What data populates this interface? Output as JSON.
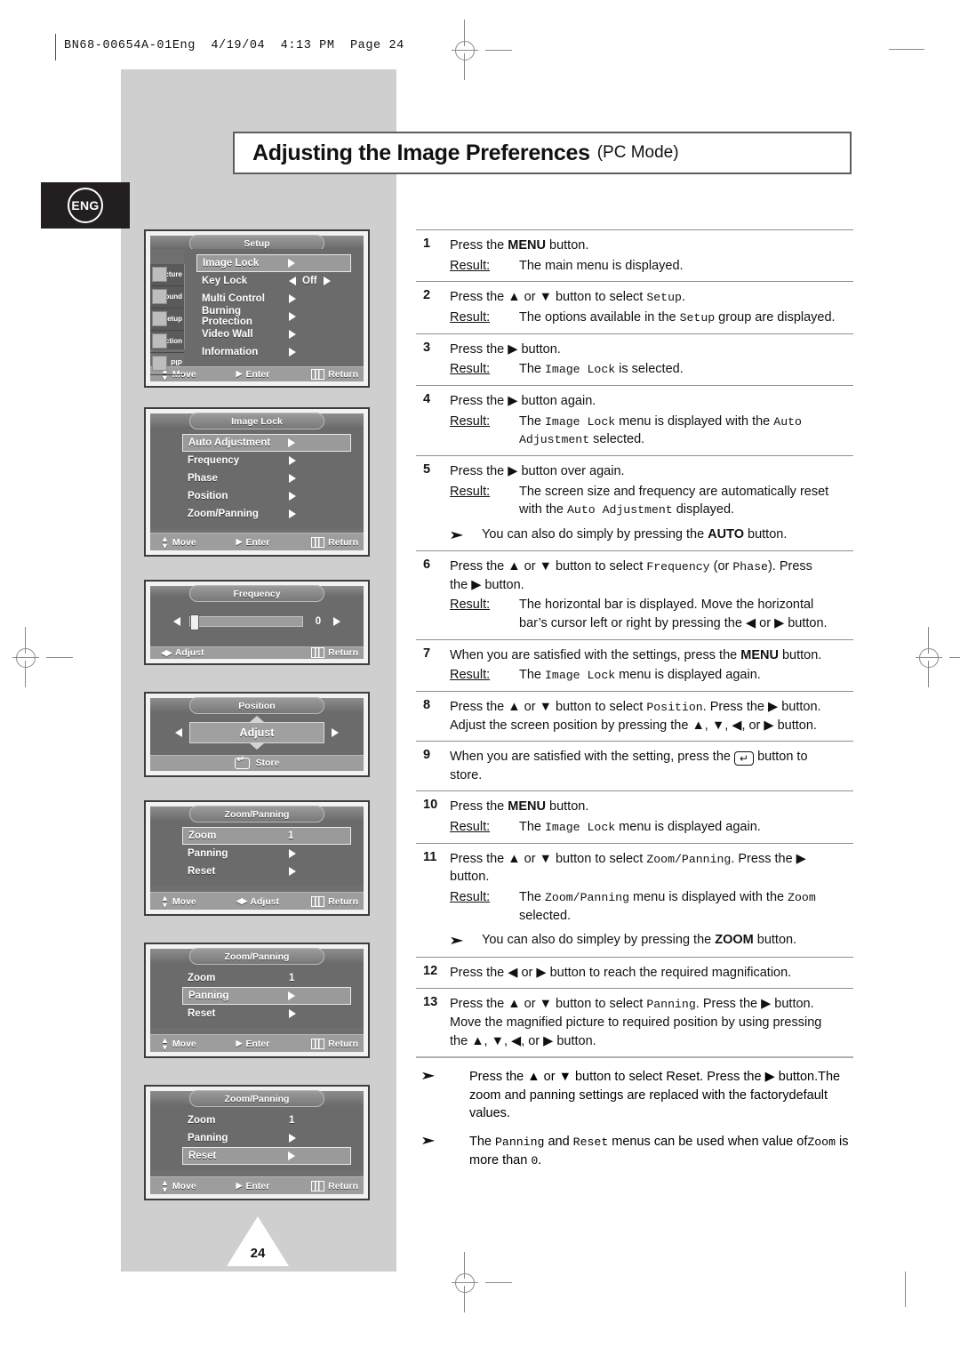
{
  "print": {
    "slug": "BN68-00654A-01Eng  4/19/04  4:13 PM  Page 24",
    "page_number": "24",
    "lang_badge": "ENG"
  },
  "title": {
    "main": "Adjusting the Image Preferences",
    "sub": "(PC Mode)"
  },
  "osd": {
    "setup": {
      "title": "Setup",
      "sidebar": [
        "Picture",
        "Sound",
        "Setup",
        "Function",
        "PIP"
      ],
      "rows": [
        {
          "label": "Image Lock",
          "value": "",
          "arrow": "right",
          "selected": true
        },
        {
          "label": "Key Lock",
          "value": "Off",
          "arrow": "leftright",
          "selected": false
        },
        {
          "label": "Multi Control",
          "value": "",
          "arrow": "right",
          "selected": false
        },
        {
          "label": "Burning Protection",
          "value": "",
          "arrow": "right",
          "selected": false
        },
        {
          "label": "Video Wall",
          "value": "",
          "arrow": "right",
          "selected": false
        },
        {
          "label": "Information",
          "value": "",
          "arrow": "right",
          "selected": false
        }
      ],
      "footer": [
        "Move",
        "Enter",
        "Return"
      ]
    },
    "image_lock": {
      "title": "Image Lock",
      "rows": [
        {
          "label": "Auto Adjustment",
          "arrow": "right",
          "selected": true
        },
        {
          "label": "Frequency",
          "arrow": "right",
          "selected": false
        },
        {
          "label": "Phase",
          "arrow": "right",
          "selected": false
        },
        {
          "label": "Position",
          "arrow": "right",
          "selected": false
        },
        {
          "label": "Zoom/Panning",
          "arrow": "right",
          "selected": false
        }
      ],
      "footer": [
        "Move",
        "Enter",
        "Return"
      ]
    },
    "frequency": {
      "title": "Frequency",
      "value": "0",
      "footer": [
        "Adjust",
        "Return"
      ]
    },
    "position": {
      "title": "Position",
      "center_label": "Adjust",
      "footer": [
        "Store"
      ]
    },
    "zoom_panning_1": {
      "title": "Zoom/Panning",
      "rows": [
        {
          "label": "Zoom",
          "value": "1",
          "arrow": "none",
          "selected": true
        },
        {
          "label": "Panning",
          "value": "",
          "arrow": "right",
          "selected": false
        },
        {
          "label": "Reset",
          "value": "",
          "arrow": "right",
          "selected": false
        }
      ],
      "footer": [
        "Move",
        "Adjust",
        "Return"
      ]
    },
    "zoom_panning_2": {
      "title": "Zoom/Panning",
      "rows": [
        {
          "label": "Zoom",
          "value": "1",
          "arrow": "none",
          "selected": false
        },
        {
          "label": "Panning",
          "value": "",
          "arrow": "right",
          "selected": true
        },
        {
          "label": "Reset",
          "value": "",
          "arrow": "right",
          "selected": false
        }
      ],
      "footer": [
        "Move",
        "Enter",
        "Return"
      ]
    },
    "zoom_panning_3": {
      "title": "Zoom/Panning",
      "rows": [
        {
          "label": "Zoom",
          "value": "1",
          "arrow": "none",
          "selected": false
        },
        {
          "label": "Panning",
          "value": "",
          "arrow": "right",
          "selected": false
        },
        {
          "label": "Reset",
          "value": "",
          "arrow": "right",
          "selected": true
        }
      ],
      "footer": [
        "Move",
        "Enter",
        "Return"
      ]
    }
  },
  "steps": [
    {
      "num": "1",
      "lines": [
        "Press the |b|MENU| button."
      ],
      "result_label": "Result:",
      "result_lines": [
        "The main menu is displayed."
      ],
      "notes": []
    },
    {
      "num": "2",
      "lines": [
        "Press the |tu| or |td| button to select |m|Setup|."
      ],
      "result_label": "Result:",
      "result_lines": [
        "The options available in the |m|Setup| group are displayed."
      ],
      "notes": []
    },
    {
      "num": "3",
      "lines": [
        "Press the |tr| button."
      ],
      "result_label": "Result:",
      "result_lines": [
        "The |m|Image Lock| is selected."
      ],
      "notes": []
    },
    {
      "num": "4",
      "lines": [
        "Press the |tr| button again."
      ],
      "result_label": "Result:",
      "result_lines": [
        "The |m|Image Lock| menu is displayed with the |m|Auto|",
        "|m|Adjustment| selected."
      ],
      "notes": []
    },
    {
      "num": "5",
      "lines": [
        "Press the |tr| button over again."
      ],
      "result_label": "Result:",
      "result_lines": [
        "The screen size and frequency are automatically reset",
        "with the |m|Auto Adjustment| displayed."
      ],
      "notes": [
        "You can also do simply by pressing the |b|AUTO| button."
      ]
    },
    {
      "num": "6",
      "lines": [
        "Press the |tu| or |td| button to select |m|Frequency| (or |m|Phase|). Press",
        "the |tr| button."
      ],
      "result_label": "Result:",
      "result_lines": [
        "The horizontal bar is displayed. Move the horizontal",
        "bar’s cursor left or right by pressing the |tl| or |tr| button."
      ],
      "notes": []
    },
    {
      "num": "7",
      "lines": [
        "When you are satisfied with the settings, press the |b|MENU| button."
      ],
      "result_label": "Result:",
      "result_lines": [
        "The |m|Image Lock| menu is displayed again."
      ],
      "notes": []
    },
    {
      "num": "8",
      "lines": [
        "Press the |tu| or |td| button to select |m|Position|. Press the |tr| button.",
        "Adjust the screen position by pressing the |tu|, |td|, |tl|, or |tr| button."
      ],
      "result_label": "",
      "result_lines": [],
      "notes": []
    },
    {
      "num": "9",
      "lines": [
        "When you are satisfied with the setting, press the |key| button to",
        "store."
      ],
      "result_label": "",
      "result_lines": [],
      "notes": []
    },
    {
      "num": "10",
      "lines": [
        "Press the |b|MENU| button."
      ],
      "result_label": "Result:",
      "result_lines": [
        "The |m|Image Lock| menu is displayed again."
      ],
      "notes": []
    },
    {
      "num": "11",
      "lines": [
        "Press the |tu| or |td| button to select |m|Zoom/Panning|. Press the |tr|",
        "button."
      ],
      "result_label": "Result:",
      "result_lines": [
        "The |m|Zoom/Panning| menu is displayed with the |m|Zoom|",
        "selected."
      ],
      "notes": [
        "You can also do simpley by pressing the |b|ZOOM| button."
      ]
    },
    {
      "num": "12",
      "lines": [
        "Press the |tl| or |tr| button to reach the required magnification."
      ],
      "result_label": "",
      "result_lines": [],
      "notes": []
    },
    {
      "num": "13",
      "lines": [
        "Press the |tu| or |td| button to select |m|Panning|. Press the |tr| button.",
        "Move the magnified picture to required position by using pressing",
        "the |tu|, |td|, |tl|, or |tr| button."
      ],
      "result_label": "",
      "result_lines": [],
      "notes": []
    }
  ],
  "trailing_notes": [
    [
      "Press the |tu| or |td| button to select Reset. Press the |tr| button.",
      "The zoom and panning settings are replaced with the factory",
      "default values."
    ],
    [
      "The |m|Panning| and |m|Reset| menus can be used when value of",
      "|m|Zoom| is more than |m|0|."
    ]
  ]
}
